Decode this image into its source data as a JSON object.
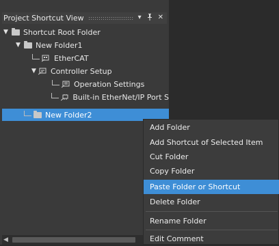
{
  "panel": {
    "title": "Project Shortcut View",
    "dropdown_glyph": "▾",
    "pin_glyph": "ᵽ",
    "close_glyph": "✕"
  },
  "tree": {
    "items": [
      {
        "label": "Shortcut Root Folder",
        "icon": "folder-icon",
        "expand": "▼"
      },
      {
        "label": "New Folder1",
        "icon": "folder-icon",
        "expand": "▼"
      },
      {
        "label": "EtherCAT",
        "icon": "ethercat-shortcut-icon"
      },
      {
        "label": "Controller Setup",
        "icon": "controller-setup-shortcut-icon",
        "expand": "▼"
      },
      {
        "label": "Operation Settings",
        "icon": "operation-settings-shortcut-icon"
      },
      {
        "label": "Built-in EtherNet/IP Port S",
        "icon": "ethernet-port-shortcut-icon"
      },
      {
        "label": "New Folder2",
        "icon": "folder-icon",
        "selected": true
      }
    ]
  },
  "context_menu": {
    "items": [
      {
        "label": "Add Folder"
      },
      {
        "label": "Add Shortcut of Selected Item"
      },
      {
        "label": "Cut Folder"
      },
      {
        "label": "Copy Folder"
      },
      {
        "label": "Paste Folder or Shortcut",
        "highlighted": true
      },
      {
        "label": "Delete Folder"
      },
      {
        "label": "Rename Folder"
      },
      {
        "label": "Edit Comment"
      }
    ]
  },
  "colors": {
    "selection": "#3e8ed6",
    "panel_bg": "#3a3a3a",
    "workspace_bg": "#2b2b2b"
  }
}
